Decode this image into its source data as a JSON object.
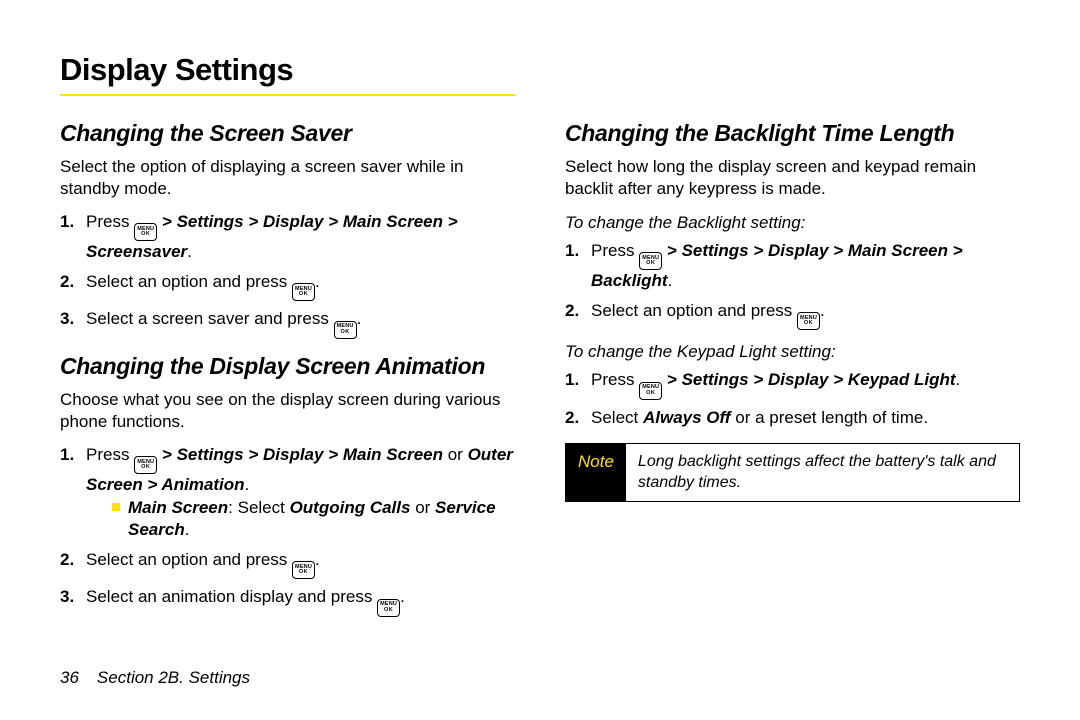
{
  "pageTitle": "Display Settings",
  "footer": {
    "pageNum": "36",
    "section": "Section 2B. Settings"
  },
  "iconLabel": {
    "line1": "MENU",
    "line2": "OK"
  },
  "left": {
    "s1": {
      "heading": "Changing the Screen Saver",
      "intro": "Select the option of displaying a screen saver while in standby mode.",
      "step1_a": "Press ",
      "step1_b": " > ",
      "step1_path": "Settings > Display > Main Screen > Screensaver",
      "step1_c": ".",
      "step2_a": "Select an option and press ",
      "step2_b": ".",
      "step3_a": "Select a screen saver and press ",
      "step3_b": "."
    },
    "s2": {
      "heading": "Changing the Display Screen Animation",
      "intro": "Choose what you see on the display screen during various phone functions.",
      "step1_a": "Press ",
      "step1_b": " > ",
      "step1_path": "Settings > Display > Main Screen",
      "step1_or": " or ",
      "step1_path2": "Outer Screen > Animation",
      "step1_c": ".",
      "bullet_label": "Main Screen",
      "bullet_mid": ": Select ",
      "bullet_opt1": "Outgoing Calls",
      "bullet_or": " or ",
      "bullet_opt2": "Service Search",
      "bullet_end": ".",
      "step2_a": "Select an option and press ",
      "step2_b": ".",
      "step3_a": "Select an animation display and press ",
      "step3_b": "."
    }
  },
  "right": {
    "s3": {
      "heading": "Changing the Backlight Time Length",
      "intro": "Select how long the display screen and keypad remain backlit after any keypress is made.",
      "sub1": "To change the Backlight setting:",
      "b_step1_a": "Press ",
      "b_step1_b": " > ",
      "b_step1_path": "Settings > Display > Main Screen > Backlight",
      "b_step1_c": ".",
      "b_step2_a": "Select an option and press ",
      "b_step2_b": ".",
      "sub2": "To change the Keypad Light setting:",
      "k_step1_a": "Press ",
      "k_step1_b": " > ",
      "k_step1_path": "Settings > Display > Keypad Light",
      "k_step1_c": ".",
      "k_step2_a": "Select ",
      "k_step2_opt": "Always Off",
      "k_step2_b": " or a preset length of time.",
      "noteLabel": "Note",
      "noteBody": "Long backlight settings affect the battery's talk and standby times."
    }
  }
}
